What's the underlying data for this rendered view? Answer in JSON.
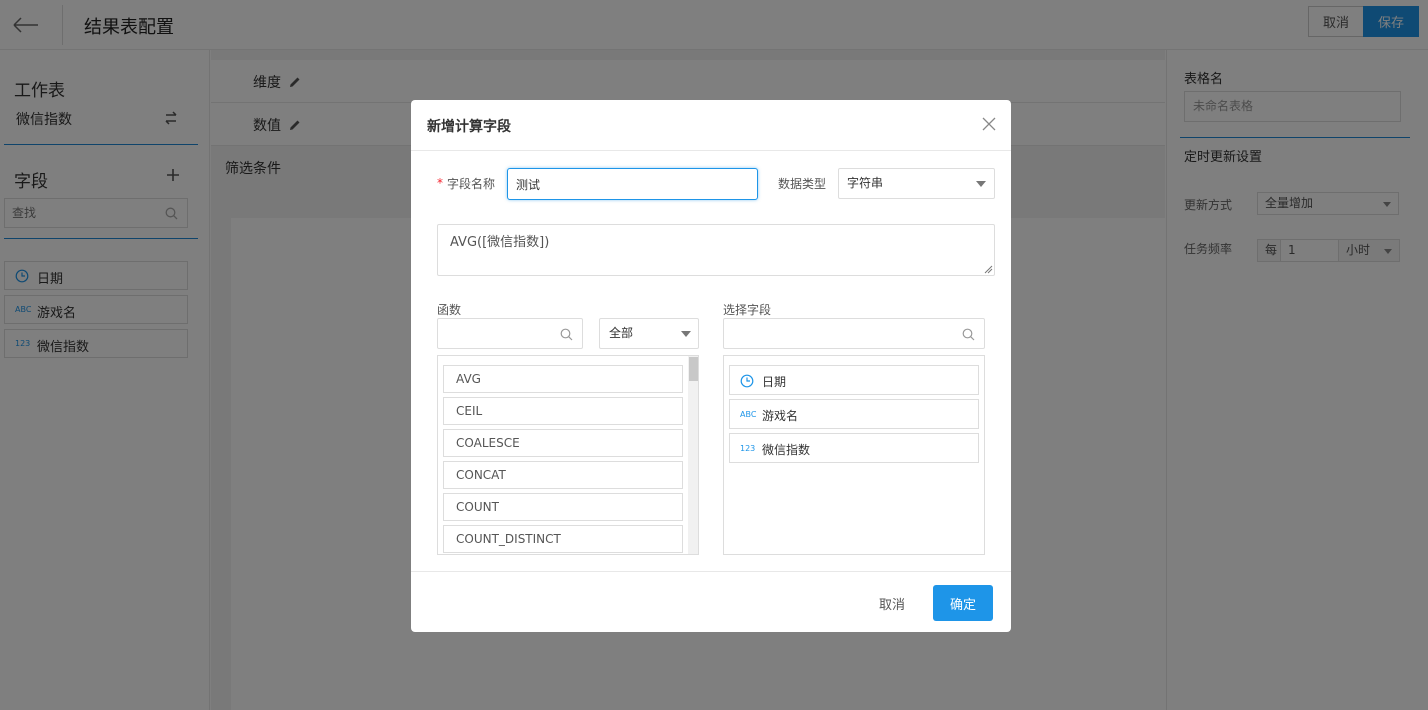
{
  "header": {
    "title": "结果表配置",
    "cancel_label": "取消",
    "save_label": "保存"
  },
  "left_panel": {
    "worksheet_heading": "工作表",
    "worksheet_name": "微信指数",
    "fields_heading": "字段",
    "search_placeholder": "查找",
    "fields": [
      {
        "icon": "clock-icon",
        "label": "日期"
      },
      {
        "icon": "abc-icon",
        "icon_text": "ABC",
        "label": "游戏名"
      },
      {
        "icon": "number-icon",
        "icon_text": "123",
        "label": "微信指数"
      }
    ]
  },
  "center": {
    "dimension_label": "维度",
    "value_label": "数值",
    "filter_label": "筛选条件"
  },
  "right_panel": {
    "table_name_label": "表格名",
    "table_name_placeholder": "未命名表格",
    "schedule_heading": "定时更新设置",
    "update_mode_label": "更新方式",
    "update_mode_value": "全量增加",
    "frequency_label": "任务频率",
    "frequency_prefix": "每",
    "frequency_value": "1",
    "frequency_unit": "小时"
  },
  "modal": {
    "title": "新增计算字段",
    "required_mark": "*",
    "field_name_label": "字段名称",
    "field_name_value": "测试",
    "data_type_label": "数据类型",
    "data_type_value": "字符串",
    "expression": "AVG([微信指数])",
    "functions_label": "函数",
    "function_category": "全部",
    "select_field_label": "选择字段",
    "functions": [
      "AVG",
      "CEIL",
      "COALESCE",
      "CONCAT",
      "COUNT",
      "COUNT_DISTINCT"
    ],
    "fields": [
      {
        "icon": "clock-icon",
        "label": "日期"
      },
      {
        "icon": "abc-icon",
        "icon_text": "ABC",
        "label": "游戏名"
      },
      {
        "icon": "number-icon",
        "icon_text": "123",
        "label": "微信指数"
      }
    ],
    "cancel_label": "取消",
    "ok_label": "确定"
  },
  "colors": {
    "accent": "#1e95e8",
    "required": "#f5222d",
    "overlay": "rgba(0,0,0,0.5)"
  }
}
